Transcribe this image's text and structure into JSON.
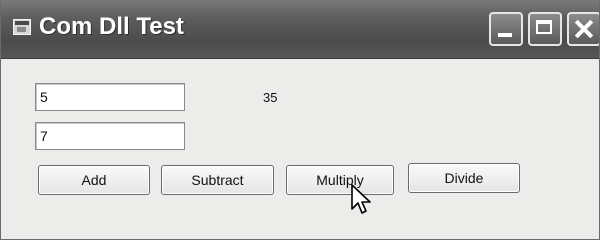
{
  "window": {
    "title": "Com Dll Test",
    "controls": {
      "minimize_icon": "minimize-icon",
      "maximize_icon": "maximize-icon",
      "close_icon": "close-icon"
    }
  },
  "form": {
    "input1": {
      "value": "5"
    },
    "input2": {
      "value": "7"
    },
    "result": "35",
    "buttons": {
      "add": "Add",
      "subtract": "Subtract",
      "multiply": "Multiply",
      "divide": "Divide"
    }
  },
  "cursor": {
    "icon": "pointer-cursor-icon"
  }
}
